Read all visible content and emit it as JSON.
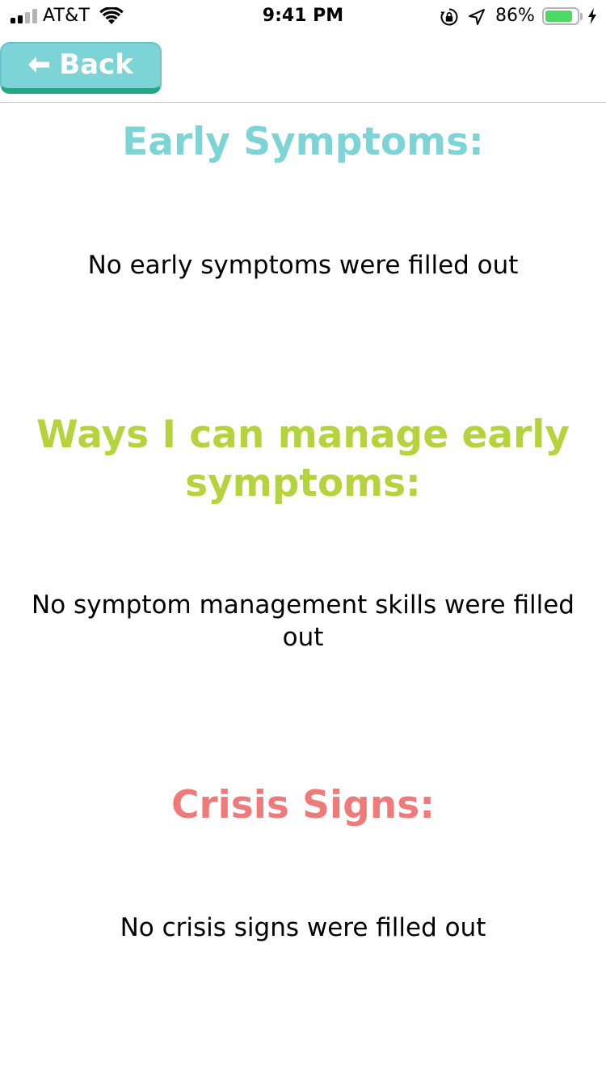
{
  "status_bar": {
    "carrier": "AT&T",
    "time": "9:41 PM",
    "battery_percent_label": "86%",
    "battery_level": 0.86,
    "signal_bars_active": 2,
    "signal_bars_total": 4,
    "icons": [
      "signal-icon",
      "wifi-icon",
      "rotation-lock-icon",
      "location-arrow-icon",
      "battery-icon",
      "charging-bolt-icon"
    ]
  },
  "header": {
    "back_label": "Back",
    "back_icon": "arrow-left-icon"
  },
  "sections": {
    "early": {
      "title": "Early Symptoms:",
      "body": "No early symptoms were filled out"
    },
    "manage": {
      "title": "Ways I can manage early symptoms:",
      "body": "No symptom management skills were filled out"
    },
    "crisis": {
      "title": "Crisis Signs:",
      "body": "No crisis signs were filled out"
    }
  },
  "colors": {
    "back_button": "#7dd4d7",
    "back_button_shadow": "#20a985",
    "early_title": "#7dd4d7",
    "manage_title": "#b5d33d",
    "crisis_title": "#ee7a7a",
    "battery_fill": "#4cd964",
    "signal_active": "#000000",
    "signal_inactive": "#b5b5b5",
    "divider": "#c8c8c8"
  }
}
